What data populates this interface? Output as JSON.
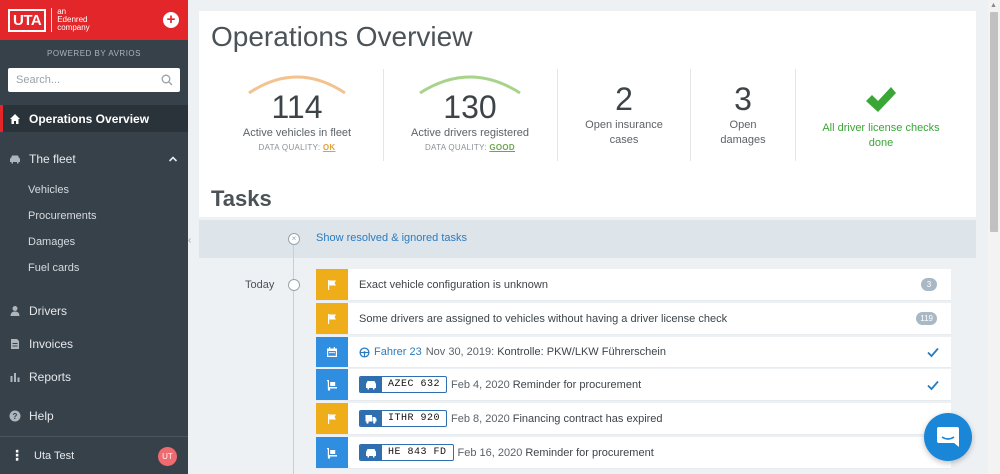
{
  "brand": {
    "logo_text": "UTA",
    "sub_line1": "an",
    "sub_line2": "Edenred",
    "sub_line3": "company",
    "powered_by": "POWERED BY AVRIOS"
  },
  "search": {
    "placeholder": "Search..."
  },
  "nav": {
    "operations": "Operations Overview",
    "fleet": "The fleet",
    "fleet_items": [
      "Vehicles",
      "Procurements",
      "Damages",
      "Fuel cards"
    ],
    "drivers": "Drivers",
    "invoices": "Invoices",
    "reports": "Reports",
    "help": "Help"
  },
  "user": {
    "name": "Uta Test",
    "initials": "UT"
  },
  "page": {
    "title": "Operations Overview",
    "tasks_title": "Tasks"
  },
  "kpis": {
    "vehicles": {
      "value": "114",
      "label": "Active vehicles in fleet",
      "dq_label": "DATA QUALITY:",
      "dq_value": "OK",
      "gauge_color": "#f2c38f"
    },
    "drivers": {
      "value": "130",
      "label": "Active drivers registered",
      "dq_label": "DATA QUALITY:",
      "dq_value": "GOOD",
      "gauge_color": "#a7d38b"
    },
    "insurance": {
      "value": "2",
      "label_line1": "Open insurance",
      "label_line2": "cases"
    },
    "damages": {
      "value": "3",
      "label_line1": "Open",
      "label_line2": "damages"
    },
    "license": {
      "label_line1": "All driver license checks",
      "label_line2": "done",
      "color": "#3aa635"
    }
  },
  "tasks": {
    "show_resolved": "Show resolved & ignored tasks",
    "today": "Today",
    "items": [
      {
        "text": "Exact vehicle configuration is unknown",
        "badge": "3",
        "icon": "flag-icon"
      },
      {
        "text": "Some drivers are assigned to vehicles without having a driver license check",
        "badge": "119",
        "icon": "flag-icon"
      },
      {
        "driver": "Fahrer 23",
        "date": "Nov 30, 2019:",
        "text": "Kontrolle: PKW/LKW Führerschein",
        "icon": "calendar-icon"
      },
      {
        "plate": "AZEC 632",
        "date": "Feb 4, 2020",
        "text": "Reminder for procurement",
        "icon": "dolly-icon"
      },
      {
        "plate": "ITHR 920",
        "date": "Feb 8, 2020",
        "text": "Financing contract has expired",
        "icon": "flag-icon"
      },
      {
        "plate": "HE 843 FD",
        "date": "Feb 16, 2020",
        "text": "Reminder for procurement",
        "icon": "dolly-icon"
      }
    ]
  },
  "colors": {
    "accent": "#e2262a",
    "sidebar": "#36414a",
    "task_yellow": "#f0ad1a",
    "task_blue": "#2f8ee0",
    "link": "#2b7bbf"
  }
}
